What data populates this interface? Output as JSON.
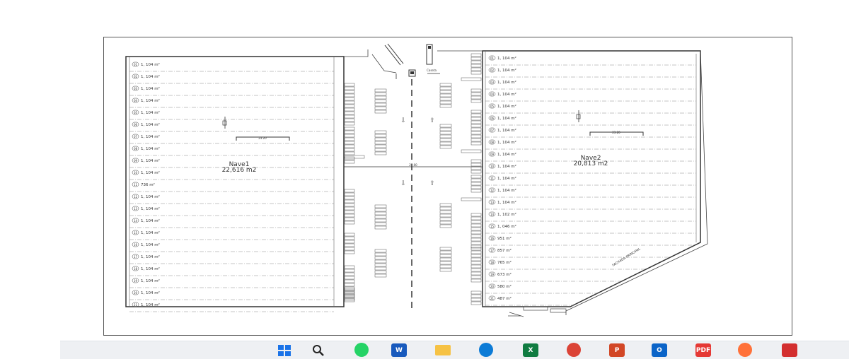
{
  "plan": {
    "nave1": {
      "name": "Nave1",
      "area": "22,616 m2",
      "dimension": "23.20",
      "units": [
        {
          "num": "01",
          "area": "1, 104 m²"
        },
        {
          "num": "02",
          "area": "1, 104 m²"
        },
        {
          "num": "03",
          "area": "1, 104 m²"
        },
        {
          "num": "04",
          "area": "1, 104 m²"
        },
        {
          "num": "05",
          "area": "1, 104 m²"
        },
        {
          "num": "06",
          "area": "1, 104 m²"
        },
        {
          "num": "07",
          "area": "1, 104 m²"
        },
        {
          "num": "08",
          "area": "1, 104 m²"
        },
        {
          "num": "09",
          "area": "1, 104 m²"
        },
        {
          "num": "10",
          "area": "1, 104 m²"
        },
        {
          "num": "11",
          "area": "736 m²"
        },
        {
          "num": "12",
          "area": "1, 104 m²"
        },
        {
          "num": "13",
          "area": "1, 104 m²"
        },
        {
          "num": "14",
          "area": "1, 104 m²"
        },
        {
          "num": "15",
          "area": "1, 104 m²"
        },
        {
          "num": "16",
          "area": "1, 104 m²"
        },
        {
          "num": "17",
          "area": "1, 104 m²"
        },
        {
          "num": "18",
          "area": "1, 104 m²"
        },
        {
          "num": "19",
          "area": "1, 104 m²"
        },
        {
          "num": "20",
          "area": "1, 104 m²"
        },
        {
          "num": "21",
          "area": "1, 104 m²"
        }
      ]
    },
    "nave2": {
      "name": "Nave2",
      "area": "20,813 m2",
      "dimension": "23.20",
      "units": [
        {
          "num": "01",
          "area": "1, 104 m²"
        },
        {
          "num": "02",
          "area": "1, 104 m²"
        },
        {
          "num": "03",
          "area": "1, 104 m²"
        },
        {
          "num": "04",
          "area": "1, 104 m²"
        },
        {
          "num": "05",
          "area": "1, 104 m²"
        },
        {
          "num": "06",
          "area": "1, 104 m²"
        },
        {
          "num": "07",
          "area": "1, 104 m²"
        },
        {
          "num": "08",
          "area": "1, 104 m²"
        },
        {
          "num": "09",
          "area": "1, 104 m²"
        },
        {
          "num": "10",
          "area": "1, 104 m²"
        },
        {
          "num": "11",
          "area": "1, 104 m²"
        },
        {
          "num": "12",
          "area": "1, 104 m²"
        },
        {
          "num": "13",
          "area": "1, 104 m²"
        },
        {
          "num": "14",
          "area": "1, 102 m²"
        },
        {
          "num": "15",
          "area": "1, 046 m²"
        },
        {
          "num": "16",
          "area": "951 m²"
        },
        {
          "num": "17",
          "area": "857 m²"
        },
        {
          "num": "18",
          "area": "765 m²"
        },
        {
          "num": "19",
          "area": "673 m²"
        },
        {
          "num": "20",
          "area": "580 m²"
        },
        {
          "num": "21",
          "area": "487 m²"
        }
      ]
    },
    "center_dimension": "27.00",
    "facade_label": "FACHADA PRINCIPAL",
    "gate_label": "Caseta"
  },
  "taskbar": {
    "background": "#eef0f3",
    "icons": [
      {
        "name": "start-icon",
        "glyph": "",
        "color": "#1a73e8"
      },
      {
        "name": "search-icon",
        "glyph": "",
        "color": "#222222"
      },
      {
        "name": "whatsapp-icon",
        "glyph": "",
        "color": "#25d366"
      },
      {
        "name": "word-icon",
        "glyph": "W",
        "color": "#185abd"
      },
      {
        "name": "file-explorer-icon",
        "glyph": "",
        "color": "#f6c244"
      },
      {
        "name": "edge-icon",
        "glyph": "",
        "color": "#0c7bd6"
      },
      {
        "name": "excel-icon",
        "glyph": "X",
        "color": "#107c41"
      },
      {
        "name": "chrome-icon",
        "glyph": "",
        "color": "#db4437"
      },
      {
        "name": "powerpoint-icon",
        "glyph": "P",
        "color": "#d24726"
      },
      {
        "name": "outlook-icon",
        "glyph": "O",
        "color": "#0a64c8"
      },
      {
        "name": "pdf-app-icon",
        "glyph": "PDF",
        "color": "#e53935"
      },
      {
        "name": "firefox-icon",
        "glyph": "",
        "color": "#ff7139"
      },
      {
        "name": "acrobat-icon",
        "glyph": "",
        "color": "#d32f2f"
      }
    ]
  }
}
